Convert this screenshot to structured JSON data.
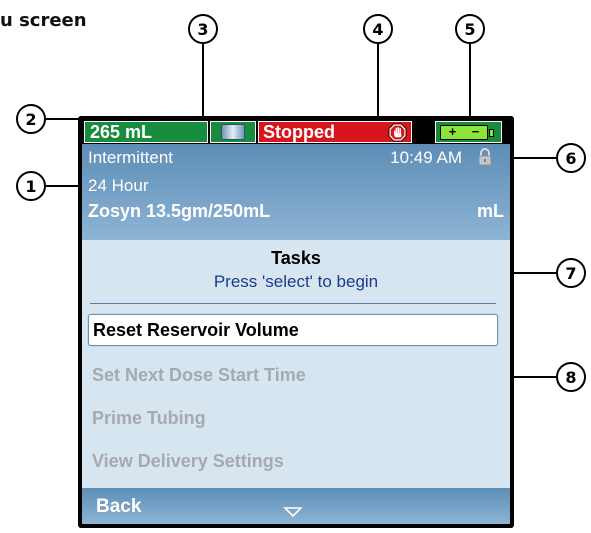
{
  "caption": "u screen",
  "callouts": [
    "1",
    "2",
    "3",
    "4",
    "5",
    "6",
    "7",
    "8"
  ],
  "status_bar": {
    "volume": "265 mL",
    "reservoir_icon": "reservoir-icon",
    "state": "Stopped",
    "stop_icon": "stop-hand-icon",
    "battery_icon": "battery-icon",
    "battery_plus": "+",
    "battery_minus": "−"
  },
  "info": {
    "mode": "Intermittent",
    "duration": "24 Hour",
    "drug": "Zosyn 13.5gm/250mL",
    "time": "10:49 AM",
    "lock_icon": "lock-icon",
    "units": "mL"
  },
  "tasks": {
    "title": "Tasks",
    "hint": "Press 'select' to begin",
    "items": [
      {
        "label": "Reset Reservoir Volume",
        "selected": true
      },
      {
        "label": "Set Next Dose Start Time",
        "selected": false
      },
      {
        "label": "Prime Tubing",
        "selected": false
      },
      {
        "label": "View Delivery Settings",
        "selected": false
      }
    ]
  },
  "softkeys": {
    "left": "Back",
    "scroll_icon": "scroll-down-icon"
  },
  "colors": {
    "status_green": "#168c3c",
    "status_red": "#d8141d",
    "battery_green": "#8ce63a",
    "header_blue": "#5d8db6",
    "screen_bg": "#d7e5f1",
    "hint_blue": "#1a3c8e",
    "disabled_text": "#a6a9ad"
  }
}
